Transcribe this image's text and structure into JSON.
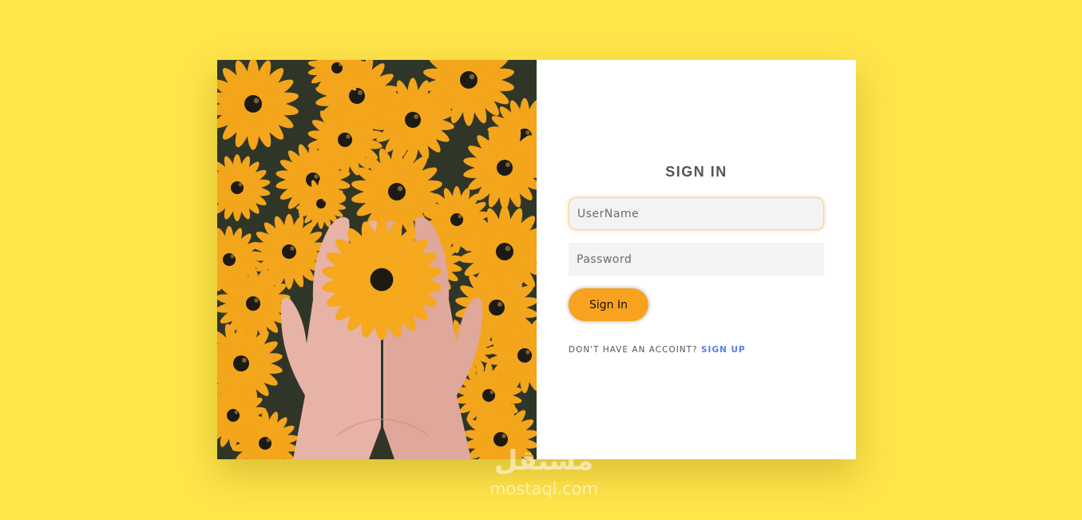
{
  "form": {
    "title": "SIGN IN",
    "username_placeholder": "UserName",
    "password_placeholder": "Password",
    "signin_label": "Sign In",
    "signup_prompt": "DON'T HAVE AN ACCOINT?",
    "signup_link": "SIGN UP"
  },
  "watermark": {
    "arabic": "مستقل",
    "latin": "mostaql.com"
  },
  "colors": {
    "background": "#ffe44a",
    "accent": "#f9a21f",
    "link": "#5b7de8"
  }
}
